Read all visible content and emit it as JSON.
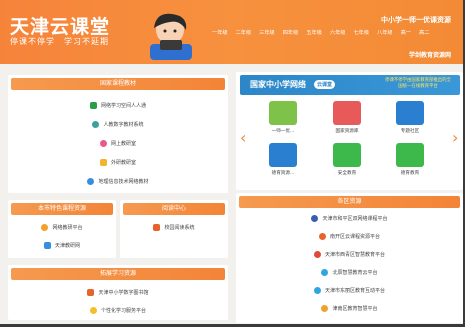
{
  "header": {
    "title": "天津云课堂",
    "subtitle": "停课不停学　学习不延期",
    "top_link": "中小学一师一优课资源",
    "grades": [
      "一年级",
      "二年级",
      "三年级",
      "四年级",
      "五年级",
      "六年级",
      "七年级",
      "八年级",
      "高一",
      "高二"
    ],
    "side_link": "学剑教育资源网",
    "accent": "#f6833a"
  },
  "national": {
    "head": "国家课程教材",
    "items": [
      {
        "label": "网络学习空间人人通",
        "icon": "grid-icon",
        "color": "#2a9d4a"
      },
      {
        "label": "人教数字教材系统",
        "icon": "circle-icon",
        "color": "#3aa0a0"
      },
      {
        "label": "网上教研室",
        "icon": "flower-icon",
        "color": "#e85a8a"
      },
      {
        "label": "外研教研室",
        "icon": "square-icon",
        "color": "#f3b32a"
      },
      {
        "label": "地理信息技术网络教材",
        "icon": "globe-icon",
        "color": "#3a8ee0"
      }
    ]
  },
  "local": {
    "head": "本市特色课程资源",
    "items": [
      {
        "label": "网络教研平台",
        "icon": "sun-icon",
        "color": "#f2a12a"
      },
      {
        "label": "天津教研网",
        "icon": "leaf-icon",
        "color": "#3a8ee0"
      }
    ]
  },
  "reading": {
    "head": "阅读中心",
    "items": [
      {
        "label": "校园阅读系统",
        "icon": "book-icon",
        "color": "#e8632a"
      }
    ]
  },
  "extend": {
    "head": "拓展学习资源",
    "items": [
      {
        "label": "天津中小学数字图书馆",
        "icon": "library-icon",
        "color": "#e8632a"
      },
      {
        "label": "个性化学习服务平台",
        "icon": "star-icon",
        "color": "#f2c12a"
      }
    ]
  },
  "banner": {
    "title": "国家中小学网络",
    "title_suffix": "云课堂",
    "sub": "停课不停学由国家教育部推出的全国统一在线教育平台"
  },
  "tiles": [
    {
      "label": "一师一优...",
      "icon": "ppt-icon",
      "color": "#7ec24a"
    },
    {
      "label": "国家资源库",
      "icon": "library-icon",
      "color": "#e85a5a"
    },
    {
      "label": "专题社区",
      "icon": "doc-icon",
      "color": "#2b7fd0"
    },
    {
      "label": "德育资源...",
      "icon": "cart-icon",
      "color": "#2b7fd0"
    },
    {
      "label": "安全教育",
      "icon": "shield-icon",
      "color": "#3db84a"
    },
    {
      "label": "德育教育",
      "icon": "screen-icon",
      "color": "#3db84a"
    }
  ],
  "districts": {
    "head": "各区资源",
    "items": [
      {
        "label": "天津市和平区双网络课程平台",
        "icon": "dot-icon",
        "color": "#3a5fb0"
      },
      {
        "label": "南开区云课程资源平台",
        "icon": "dot-icon",
        "color": "#e8632a"
      },
      {
        "label": "天津市西青区智慧教育平台",
        "icon": "dot-icon",
        "color": "#e04a3a"
      },
      {
        "label": "北辰智慧教育云平台",
        "icon": "dot-icon",
        "color": "#2ea7e0"
      },
      {
        "label": "天津市东丽区教育互动平台",
        "icon": "dot-icon",
        "color": "#2ea7e0"
      },
      {
        "label": "津南区教育智慧平台",
        "icon": "dot-icon",
        "color": "#f2a12a"
      }
    ]
  }
}
